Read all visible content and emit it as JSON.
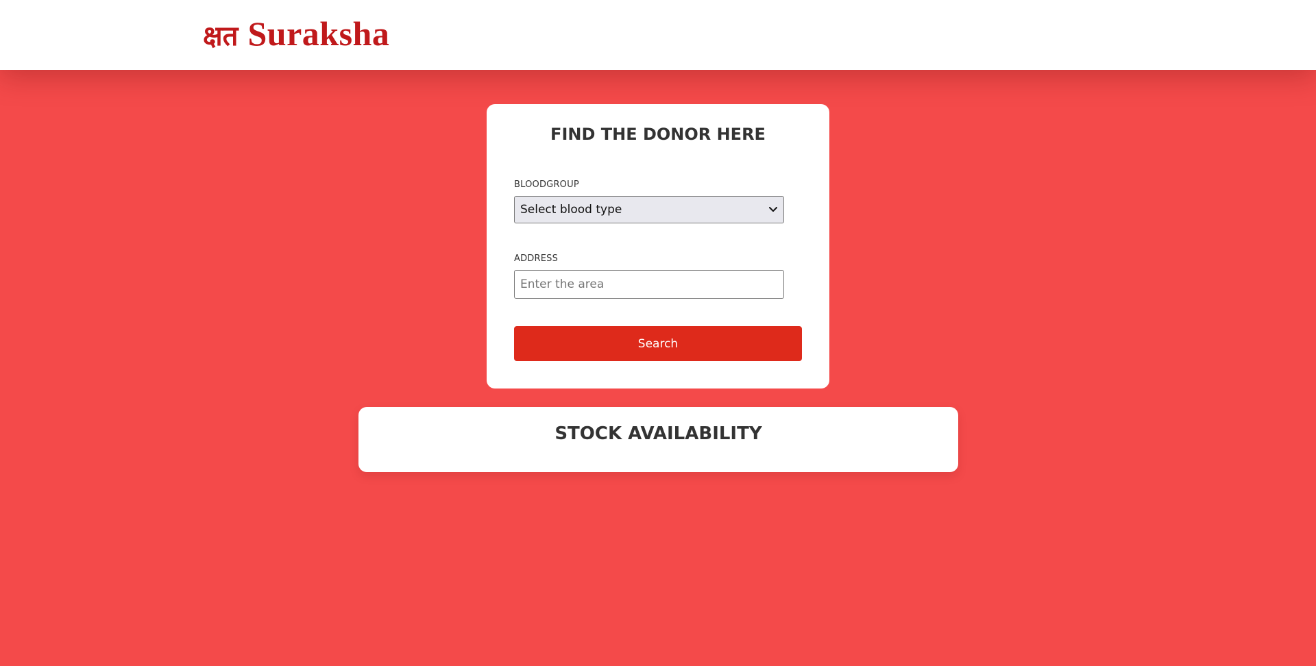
{
  "header": {
    "logo_glyph": "क्षत",
    "logo_text": "Suraksha"
  },
  "donor_search": {
    "title": "FIND THE DONOR HERE",
    "bloodgroup_label": "BLOODGROUP",
    "bloodgroup_value": "Select blood type",
    "address_label": "ADDRESS",
    "address_placeholder": "Enter the area",
    "address_value": "",
    "search_label": "Search"
  },
  "stock": {
    "title": "STOCK AVAILABILITY"
  },
  "colors": {
    "background": "#f44a4a",
    "brand": "#c0191b",
    "button": "#de2a1b",
    "card": "#ffffff",
    "select_bg": "#e8e8ee"
  },
  "icons": {
    "select_arrow": "chevron-down-icon"
  }
}
